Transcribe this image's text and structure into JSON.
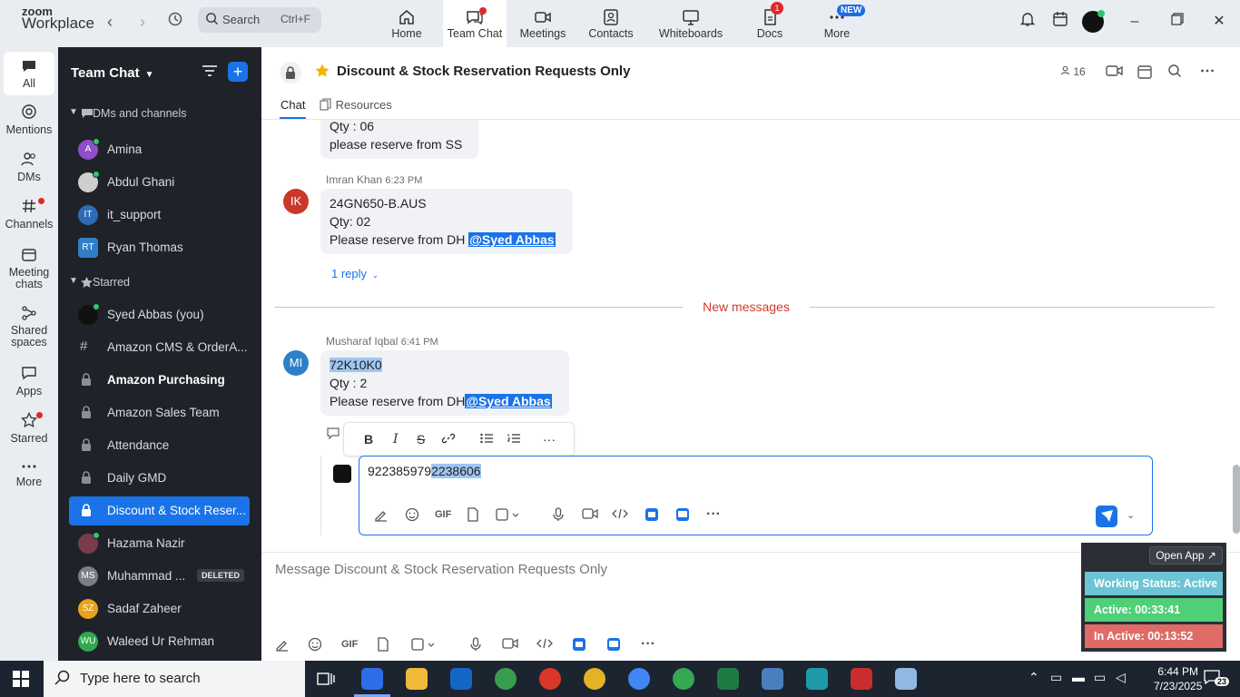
{
  "app": {
    "logo_line1": "zoom",
    "logo_line2": "Workplace"
  },
  "search": {
    "label": "Search",
    "shortcut": "Ctrl+F"
  },
  "tabs": [
    {
      "label": "Home"
    },
    {
      "label": "Team Chat"
    },
    {
      "label": "Meetings"
    },
    {
      "label": "Contacts"
    },
    {
      "label": "Whiteboards"
    },
    {
      "label": "Docs",
      "badge": "1"
    },
    {
      "label": "More",
      "badge": "NEW"
    }
  ],
  "rail": [
    {
      "label": "All"
    },
    {
      "label": "Mentions"
    },
    {
      "label": "DMs"
    },
    {
      "label": "Channels"
    },
    {
      "label": "Meeting chats"
    },
    {
      "label": "Shared spaces"
    },
    {
      "label": "Apps"
    },
    {
      "label": "Starred"
    },
    {
      "label": "More"
    }
  ],
  "sidebar": {
    "title": "Team Chat",
    "sections": {
      "dms": "DMs and channels",
      "starred": "Starred"
    },
    "dms": [
      {
        "name": "Amina",
        "initials": "A",
        "color": "#8e4fc9"
      },
      {
        "name": "Abdul Ghani",
        "initials": "",
        "color": "#d9d9d9"
      },
      {
        "name": "it_support",
        "initials": "IT",
        "color": "#2f6bb5"
      },
      {
        "name": "Ryan Thomas",
        "initials": "RT",
        "color": "#2f7fc8"
      }
    ],
    "starred": [
      {
        "name": "Syed Abbas (you)"
      },
      {
        "name": "Amazon CMS & OrderA..."
      },
      {
        "name": "Amazon Purchasing"
      },
      {
        "name": "Amazon Sales Team"
      },
      {
        "name": "Attendance"
      },
      {
        "name": "Daily GMD"
      },
      {
        "name": "Discount & Stock Reser..."
      },
      {
        "name": "Hazama Nazir"
      },
      {
        "name": "Muhammad ...",
        "badge": "DELETED",
        "initials": "MS"
      },
      {
        "name": "Sadaf Zaheer",
        "initials": "SZ"
      },
      {
        "name": "Waleed Ur Rehman",
        "initials": "WU"
      }
    ]
  },
  "chat": {
    "title": "Discount & Stock Reservation Requests Only",
    "members": "16",
    "tab_chat": "Chat",
    "tab_resources": "Resources",
    "msg0": {
      "line1": "Qty : 06",
      "line2": "please reserve from SS"
    },
    "msg1": {
      "sender": "Imran Khan",
      "time": "6:23 PM",
      "initials": "IK",
      "line1": "24GN650-B.AUS",
      "line2": "Qty: 02",
      "line3": "Please reserve from DH ",
      "mention": "@Syed Abbas",
      "reply": "1 reply"
    },
    "new_messages": "New messages",
    "msg2": {
      "sender": "Musharaf Iqbal",
      "time": "6:41 PM",
      "initials": "MI",
      "line1": "72K10K0",
      "line2": "Qty : 2",
      "line3": "Please reserve from DH",
      "mention": "@Syed Abbas"
    },
    "edit_text_plain": "922385979",
    "edit_text_selected": "2238606"
  },
  "composer": {
    "placeholder": "Message Discount & Stock Reservation Requests Only"
  },
  "toolbar_labels": {
    "gif": "GIF"
  },
  "status_widget": {
    "open_app": "Open App ↗",
    "working": "Working Status: Active",
    "active": "Active: 00:33:41",
    "inactive": "In Active: 00:13:52"
  },
  "taskbar": {
    "search_placeholder": "Type here to search",
    "time": "6:44 PM",
    "date": "7/23/2025",
    "notifications": "23"
  },
  "colors": {
    "accent": "#1a73e8",
    "sidebar_bg": "#1f2329",
    "danger": "#d33a2c"
  }
}
